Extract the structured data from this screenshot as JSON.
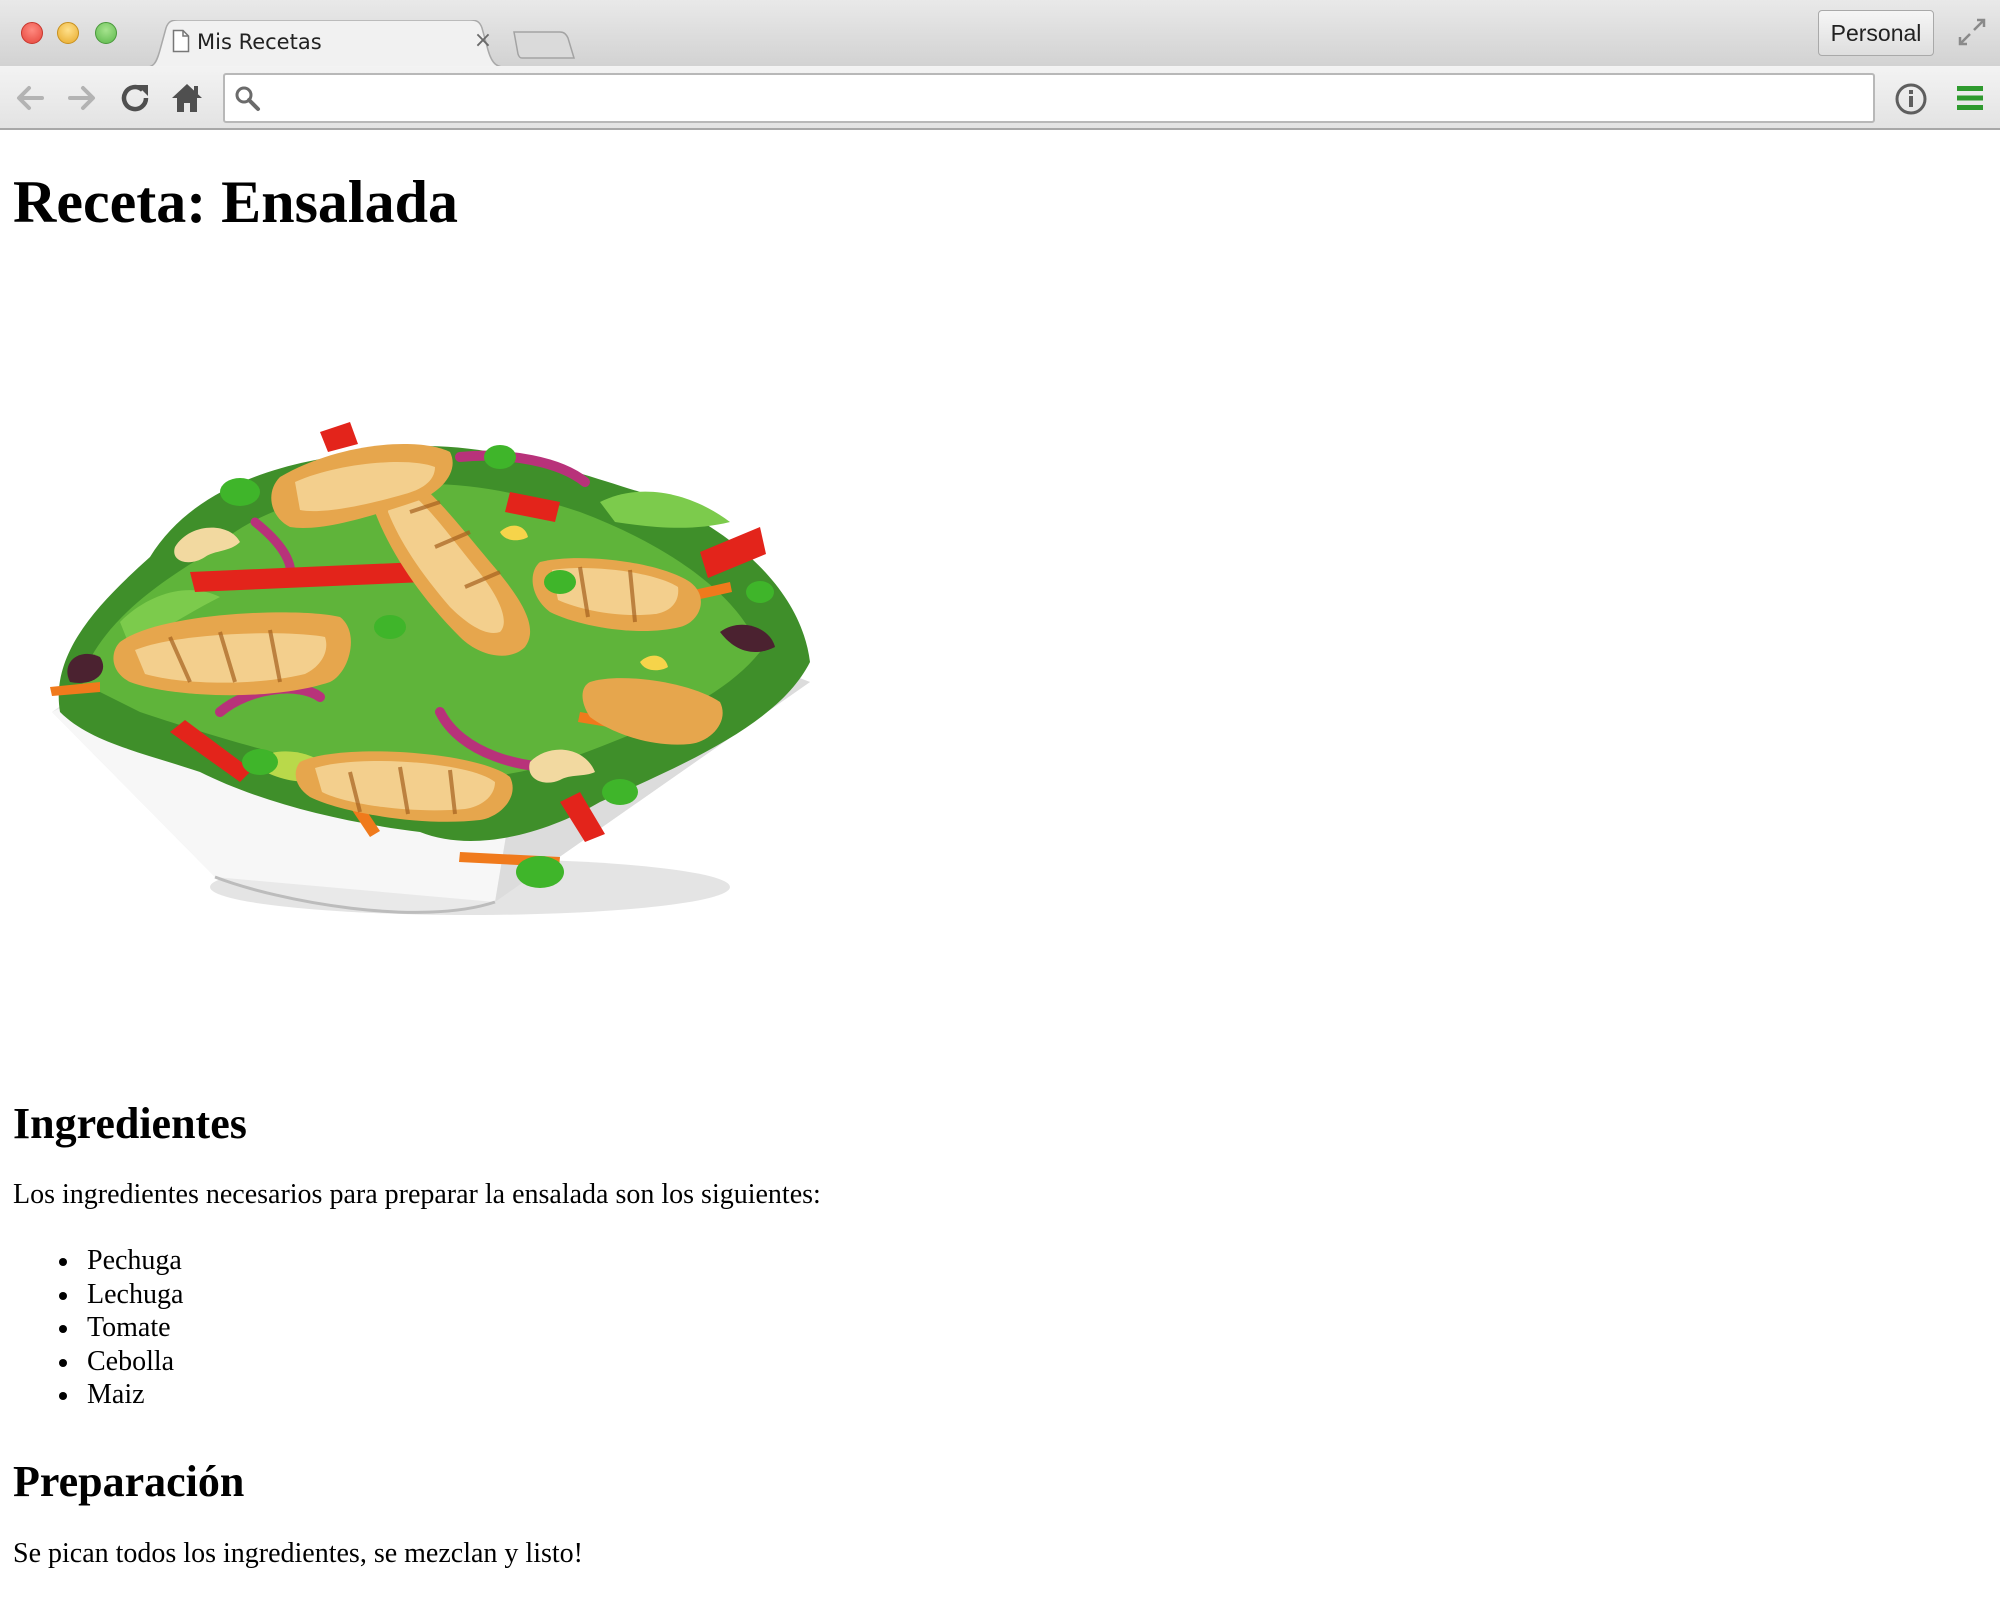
{
  "browser": {
    "tab": {
      "title": "Mis Recetas",
      "close_glyph": "×",
      "icon": "document-icon"
    },
    "profile_button_label": "Personal",
    "omnibox": {
      "value": "",
      "placeholder": ""
    },
    "icons": [
      "back-icon",
      "forward-icon",
      "reload-icon",
      "home-icon",
      "search-icon",
      "info-icon",
      "menu-icon",
      "fullscreen-icon"
    ]
  },
  "page": {
    "title": "Receta: Ensalada",
    "ingredients_heading": "Ingredientes",
    "ingredients_intro": "Los ingredientes necesarios para preparar la ensalada son los siguientes:",
    "ingredients": [
      "Pechuga",
      "Lechuga",
      "Tomate",
      "Cebolla",
      "Maiz"
    ],
    "preparation_heading": "Preparación",
    "preparation_text": "Se pican todos los ingredientes, se mezclan y listo!"
  },
  "colors": {
    "menu_icon": "#2e9a2e",
    "close_traffic": "#e5453b",
    "minimize_traffic": "#e7a92a",
    "zoom_traffic": "#5cb84b"
  }
}
